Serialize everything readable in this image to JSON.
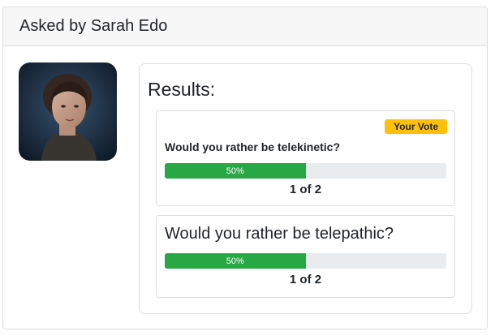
{
  "header": {
    "title": "Asked by Sarah Edo"
  },
  "avatar": {
    "alt": "Sarah Edo avatar"
  },
  "results": {
    "title": "Results:",
    "options": [
      {
        "question": "Would you rather be telekinetic?",
        "badge": "Your Vote",
        "percent_label": "50%",
        "percent": 50,
        "count_label": "1 of 2"
      },
      {
        "question": "Would you rather be telepathic?",
        "percent_label": "50%",
        "percent": 50,
        "count_label": "1 of 2"
      }
    ]
  },
  "colors": {
    "progress_fill": "#28a745",
    "progress_track": "#e9ecef",
    "vote_badge": "#ffc107"
  }
}
